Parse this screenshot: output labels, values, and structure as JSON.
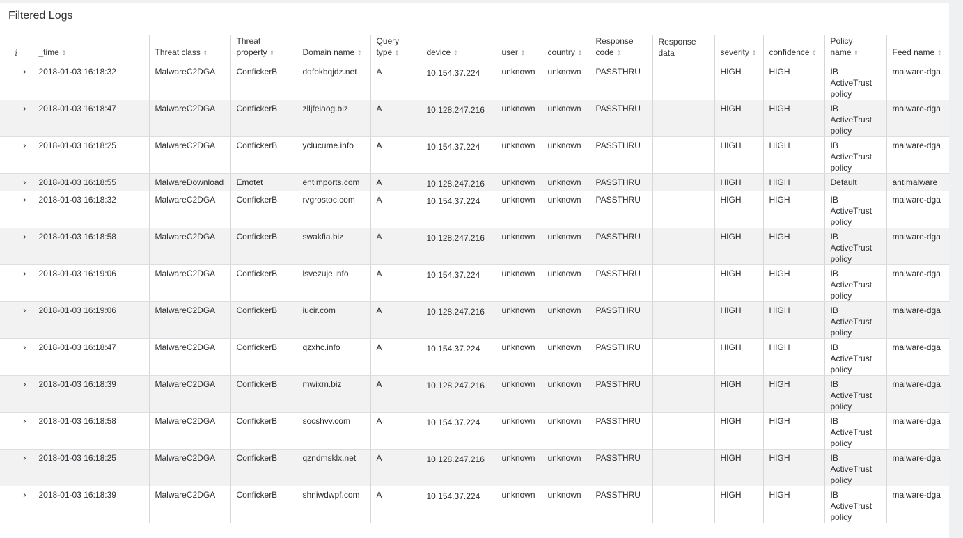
{
  "panel": {
    "title": "Filtered Logs"
  },
  "table": {
    "info_header": "i",
    "headers": [
      "_time",
      "Threat class",
      "Threat property",
      "Domain name",
      "Query type",
      "device",
      "user",
      "country",
      "Response code",
      "Response data",
      "severity",
      "confidence",
      "Policy name",
      "Feed name"
    ],
    "rows": [
      [
        "2018-01-03 16:18:32",
        "MalwareC2DGA",
        "ConfickerB",
        "dqfbkbqjdz.net",
        "A",
        "10.154.37.224",
        "unknown",
        "unknown",
        "PASSTHRU",
        "",
        "HIGH",
        "HIGH",
        "IB ActiveTrust policy",
        "malware-dga"
      ],
      [
        "2018-01-03 16:18:47",
        "MalwareC2DGA",
        "ConfickerB",
        "zlljfeiaog.biz",
        "A",
        "10.128.247.216",
        "unknown",
        "unknown",
        "PASSTHRU",
        "",
        "HIGH",
        "HIGH",
        "IB ActiveTrust policy",
        "malware-dga"
      ],
      [
        "2018-01-03 16:18:25",
        "MalwareC2DGA",
        "ConfickerB",
        "yclucume.info",
        "A",
        "10.154.37.224",
        "unknown",
        "unknown",
        "PASSTHRU",
        "",
        "HIGH",
        "HIGH",
        "IB ActiveTrust policy",
        "malware-dga"
      ],
      [
        "2018-01-03 16:18:55",
        "MalwareDownload",
        "Emotet",
        "entimports.com",
        "A",
        "10.128.247.216",
        "unknown",
        "unknown",
        "PASSTHRU",
        "",
        "HIGH",
        "HIGH",
        "Default",
        "antimalware"
      ],
      [
        "2018-01-03 16:18:32",
        "MalwareC2DGA",
        "ConfickerB",
        "rvgrostoc.com",
        "A",
        "10.154.37.224",
        "unknown",
        "unknown",
        "PASSTHRU",
        "",
        "HIGH",
        "HIGH",
        "IB ActiveTrust policy",
        "malware-dga"
      ],
      [
        "2018-01-03 16:18:58",
        "MalwareC2DGA",
        "ConfickerB",
        "swakfia.biz",
        "A",
        "10.128.247.216",
        "unknown",
        "unknown",
        "PASSTHRU",
        "",
        "HIGH",
        "HIGH",
        "IB ActiveTrust policy",
        "malware-dga"
      ],
      [
        "2018-01-03 16:19:06",
        "MalwareC2DGA",
        "ConfickerB",
        "lsvezuje.info",
        "A",
        "10.154.37.224",
        "unknown",
        "unknown",
        "PASSTHRU",
        "",
        "HIGH",
        "HIGH",
        "IB ActiveTrust policy",
        "malware-dga"
      ],
      [
        "2018-01-03 16:19:06",
        "MalwareC2DGA",
        "ConfickerB",
        "iucir.com",
        "A",
        "10.128.247.216",
        "unknown",
        "unknown",
        "PASSTHRU",
        "",
        "HIGH",
        "HIGH",
        "IB ActiveTrust policy",
        "malware-dga"
      ],
      [
        "2018-01-03 16:18:47",
        "MalwareC2DGA",
        "ConfickerB",
        "qzxhc.info",
        "A",
        "10.154.37.224",
        "unknown",
        "unknown",
        "PASSTHRU",
        "",
        "HIGH",
        "HIGH",
        "IB ActiveTrust policy",
        "malware-dga"
      ],
      [
        "2018-01-03 16:18:39",
        "MalwareC2DGA",
        "ConfickerB",
        "mwixm.biz",
        "A",
        "10.128.247.216",
        "unknown",
        "unknown",
        "PASSTHRU",
        "",
        "HIGH",
        "HIGH",
        "IB ActiveTrust policy",
        "malware-dga"
      ],
      [
        "2018-01-03 16:18:58",
        "MalwareC2DGA",
        "ConfickerB",
        "socshvv.com",
        "A",
        "10.154.37.224",
        "unknown",
        "unknown",
        "PASSTHRU",
        "",
        "HIGH",
        "HIGH",
        "IB ActiveTrust policy",
        "malware-dga"
      ],
      [
        "2018-01-03 16:18:25",
        "MalwareC2DGA",
        "ConfickerB",
        "qzndmsklx.net",
        "A",
        "10.128.247.216",
        "unknown",
        "unknown",
        "PASSTHRU",
        "",
        "HIGH",
        "HIGH",
        "IB ActiveTrust policy",
        "malware-dga"
      ],
      [
        "2018-01-03 16:18:39",
        "MalwareC2DGA",
        "ConfickerB",
        "shniwdwpf.com",
        "A",
        "10.154.37.224",
        "unknown",
        "unknown",
        "PASSTHRU",
        "",
        "HIGH",
        "HIGH",
        "IB ActiveTrust policy",
        "malware-dga"
      ]
    ]
  },
  "icons": {
    "expand": "chevron-right-icon",
    "sort": "sort-icon"
  }
}
